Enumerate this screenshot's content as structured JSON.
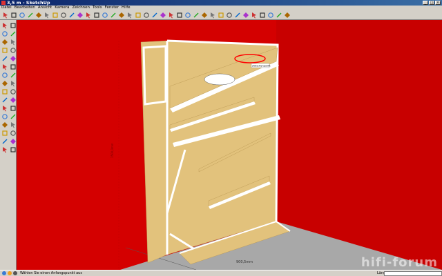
{
  "window": {
    "title": "3,5 m - SketchUp"
  },
  "menu": [
    "Datei",
    "Bearbeiten",
    "Ansicht",
    "Kamera",
    "Zeichnen",
    "Tools",
    "Fenster",
    "Hilfe"
  ],
  "toolbar_icons": [
    "select-icon",
    "pencil-icon",
    "rectangle-icon",
    "circle-icon",
    "arc-icon",
    "eraser-icon",
    "paint-bucket-icon",
    "push-pull-icon",
    "move-icon",
    "rotate-icon",
    "offset-icon",
    "tape-measure-icon",
    "text-icon",
    "axes-icon",
    "dimension-icon",
    "protractor-icon",
    "orbit-icon",
    "pan-icon",
    "zoom-icon",
    "zoom-window-icon",
    "zoom-extents-icon",
    "previous-icon",
    "next-icon",
    "iso-view-icon",
    "top-view-icon",
    "front-view-icon",
    "right-view-icon",
    "back-view-icon",
    "left-view-icon",
    "xray-icon",
    "wireframe-icon",
    "hidden-line-icon",
    "shaded-icon",
    "textured-icon",
    "monochrome-icon"
  ],
  "sidebar_icons": [
    "select-icon",
    "component-icon",
    "pencil-icon",
    "arc-icon",
    "rectangle-icon",
    "circle-icon",
    "polygon-icon",
    "freehand-icon",
    "eraser-icon",
    "paint-icon",
    "move-icon",
    "push-pull-icon",
    "rotate-icon",
    "follow-me-icon",
    "scale-icon",
    "offset-icon",
    "tape-measure-icon",
    "dimension-icon",
    "protractor-icon",
    "text-icon",
    "axes-icon",
    "3d-text-icon",
    "orbit-icon",
    "pan-icon",
    "zoom-icon",
    "zoom-window-icon",
    "zoom-extents-icon",
    "previous-view-icon",
    "position-camera-icon",
    "walk-icon",
    "look-around-icon",
    "section-plane-icon"
  ],
  "scene": {
    "dimension_label": "900,5mm",
    "height_label": "1500,0mm",
    "tooltip": "Zwischenpunkt",
    "colors": {
      "wall": "#d40000",
      "floor": "#a8a8a8",
      "wood": "#e2c27c",
      "frame": "#ffffff",
      "marker": "#ff0000"
    }
  },
  "statusbar": {
    "hint": "Wählen Sie einen Anfangspunkt aus",
    "measure_label": "Länge"
  },
  "watermark": "hifi-forum"
}
